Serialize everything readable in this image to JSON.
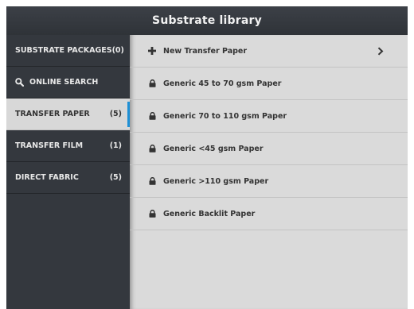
{
  "window": {
    "title": "Substrate library"
  },
  "sidebar": {
    "items": [
      {
        "label": "SUBSTRATE PACKAGES",
        "count": "(0)"
      },
      {
        "label": "ONLINE SEARCH",
        "icon": "search-icon"
      },
      {
        "label": "TRANSFER PAPER",
        "count": "(5)",
        "selected": true
      },
      {
        "label": "TRANSFER FILM",
        "count": "(1)"
      },
      {
        "label": "DIRECT FABRIC",
        "count": "(5)"
      }
    ],
    "accent_color": "#1e90d6"
  },
  "list": {
    "new_item": {
      "label": "New Transfer Paper",
      "icon": "plus-icon",
      "trailing_icon": "chevron-right-icon"
    },
    "items": [
      {
        "label": "Generic 45 to 70 gsm Paper",
        "icon": "lock-icon"
      },
      {
        "label": "Generic 70 to 110 gsm Paper",
        "icon": "lock-icon"
      },
      {
        "label": "Generic <45 gsm Paper",
        "icon": "lock-icon"
      },
      {
        "label": "Generic >110 gsm Paper",
        "icon": "lock-icon"
      },
      {
        "label": "Generic Backlit Paper",
        "icon": "lock-icon"
      }
    ]
  }
}
